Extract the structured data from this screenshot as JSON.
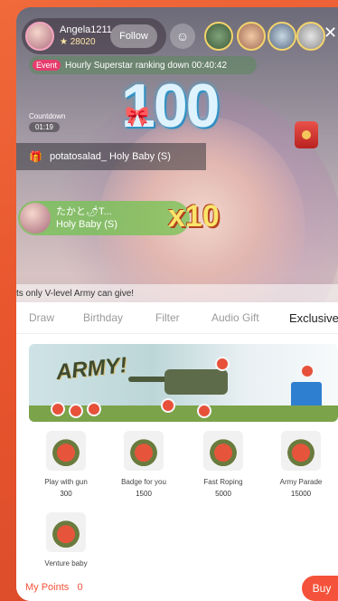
{
  "host": {
    "name": "Angela1211",
    "points": "28020",
    "follow_label": "Follow"
  },
  "ticker": {
    "tag": "Event",
    "text": "Hourly Superstar ranking down 00:40:42"
  },
  "countdown": {
    "label": "Countdown",
    "time": "01:19"
  },
  "combo_counter": "100",
  "gift_banner": {
    "text": "potatosalad_ Holy Baby (S)"
  },
  "gift_toast": {
    "user": "たかと🌶T...",
    "gift": "Holy Baby (S)",
    "multiplier": "x10"
  },
  "panel": {
    "notice": "ts only V-level Army can give!",
    "tabs": [
      "Draw",
      "Birthday",
      "Filter",
      "Audio Gift",
      "Exclusive"
    ],
    "active_tab": "Exclusive",
    "banner_text": "ARMY!",
    "gifts": [
      {
        "name": "Play with gun",
        "price": "300"
      },
      {
        "name": "Badge for you",
        "price": "1500"
      },
      {
        "name": "Fast Roping",
        "price": "5000"
      },
      {
        "name": "Army Parade",
        "price": "15000"
      },
      {
        "name": "Venture baby",
        "price": ""
      }
    ]
  },
  "footer": {
    "points_label": "My Points",
    "points_value": "0",
    "buy_label": "Buy"
  },
  "colors": {
    "accent": "#f4523a",
    "background": "#e8552e"
  }
}
